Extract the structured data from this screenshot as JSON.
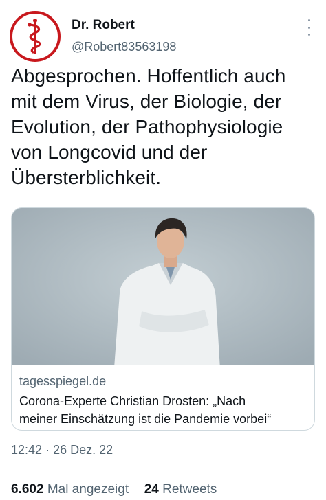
{
  "author": {
    "name": "Dr. Robert",
    "handle": "@Robert83563198"
  },
  "tweet": {
    "text": "Abgesprochen. Hoffentlich auch\nmit dem Virus, der Biologie, der\nEvolution, der Pathophysiologie\nvon Longcovid und der\nÜbersterblichkeit."
  },
  "card": {
    "domain": "tagesspiegel.de",
    "title": "Corona-Experte Christian Drosten: „Nach\nmeiner Einschätzung ist die Pandemie vorbei“"
  },
  "meta": {
    "time": "12:42",
    "separator": "·",
    "date": "26 Dez. 22"
  },
  "stats": {
    "views_count": "6.602",
    "views_label": "Mal angezeigt",
    "retweets_count": "24",
    "retweets_label": "Retweets"
  },
  "icons": {
    "avatar": "rod-of-asclepius-icon",
    "more": "more-options-icon"
  },
  "colors": {
    "avatar_red": "#c8181d",
    "secondary_text": "#536471",
    "primary_text": "#0f1419",
    "border": "#cfd9de"
  }
}
